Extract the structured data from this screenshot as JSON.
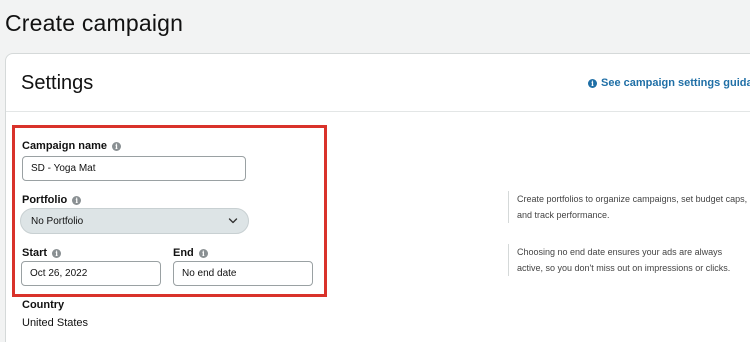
{
  "page": {
    "title": "Create campaign"
  },
  "settings": {
    "title": "Settings",
    "guidance_link": "See campaign settings guidance"
  },
  "campaign_name": {
    "label": "Campaign name",
    "value": "SD - Yoga Mat"
  },
  "portfolio": {
    "label": "Portfolio",
    "selected": "No Portfolio",
    "help": "Create portfolios to organize campaigns, set budget caps, and track performance."
  },
  "start": {
    "label": "Start",
    "value": "Oct 26, 2022"
  },
  "end": {
    "label": "End",
    "value": "No end date",
    "help": "Choosing no end date ensures your ads are always active, so you don't miss out on impressions or clicks."
  },
  "country": {
    "label": "Country",
    "value": "United States"
  },
  "colors": {
    "link": "#1f6fa6",
    "highlight": "#d9322a",
    "select_bg": "#dde4e6"
  },
  "icons": [
    "info-icon",
    "chevron-down-icon"
  ]
}
